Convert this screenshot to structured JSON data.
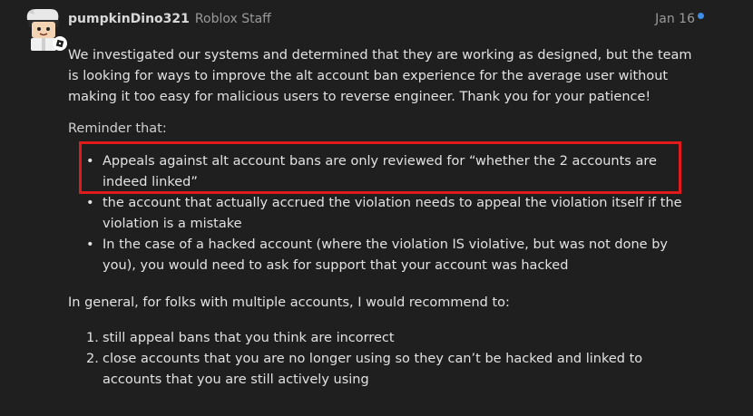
{
  "post": {
    "author": "pumpkinDino321",
    "role": "Roblox Staff",
    "date": "Jan 16",
    "paragraph1": "We investigated our systems and determined that they are working as designed, but the team is looking for ways to improve the alt account ban experience for the average user without making it too easy for malicious users to reverse engineer. Thank you for your patience!",
    "reminder_label": "Reminder that:",
    "bullets": [
      "Appeals against alt account bans are only reviewed for “whether the 2 accounts are indeed linked”",
      "the account that actually accrued the violation needs to appeal the violation itself if the violation is a mistake",
      "In the case of a hacked account (where the violation IS violative, but was not done by you), you would need to ask for support that your account was hacked"
    ],
    "general_label": "In general, for folks with multiple accounts, I would recommend to:",
    "steps": [
      "still appeal bans that you think are incorrect",
      "close accounts that you are no longer using so they can’t be hacked and linked to accounts that you are still actively using"
    ]
  },
  "colors": {
    "background": "#1f1f1f",
    "highlight_border": "#e11b1b",
    "unread_dot": "#3f8fe8"
  },
  "icons": {
    "avatar": "roblox-avatar-icon",
    "unread": "unread-dot-icon"
  }
}
